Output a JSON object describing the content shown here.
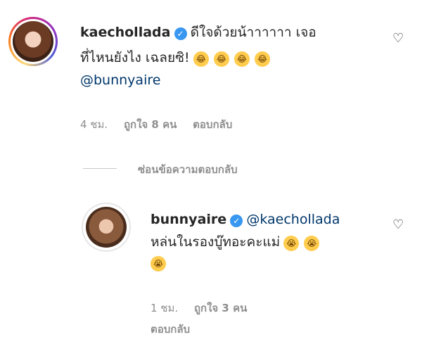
{
  "comment1": {
    "username": "kaechollada",
    "text_line1": "ดีใจด้วยน้าาาาาา เจอ",
    "text_line2": "ที่ไหนยังไง เฉลยซิ!",
    "emoji_count": 4,
    "emoji_icon": "joy-emoji-icon",
    "mention": "@bunnyaire",
    "time": "4 ชม.",
    "likes": "ถูกใจ 8 คน",
    "reply_label": "ตอบกลับ"
  },
  "hide_replies_label": "ซ่อนข้อความตอบกลับ",
  "comment2": {
    "username": "bunnyaire",
    "mention": "@kaechollada",
    "text_line1": "หล่นในรองบู๊ทอะคะแม่",
    "emoji_icon": "crying-emoji-icon",
    "time": "1 ชม.",
    "likes": "ถูกใจ 3 คน",
    "reply_label": "ตอบกลับ"
  },
  "colors": {
    "text": "#262626",
    "meta": "#8e8e8e",
    "mention": "#00376b",
    "verified": "#3897f0"
  }
}
